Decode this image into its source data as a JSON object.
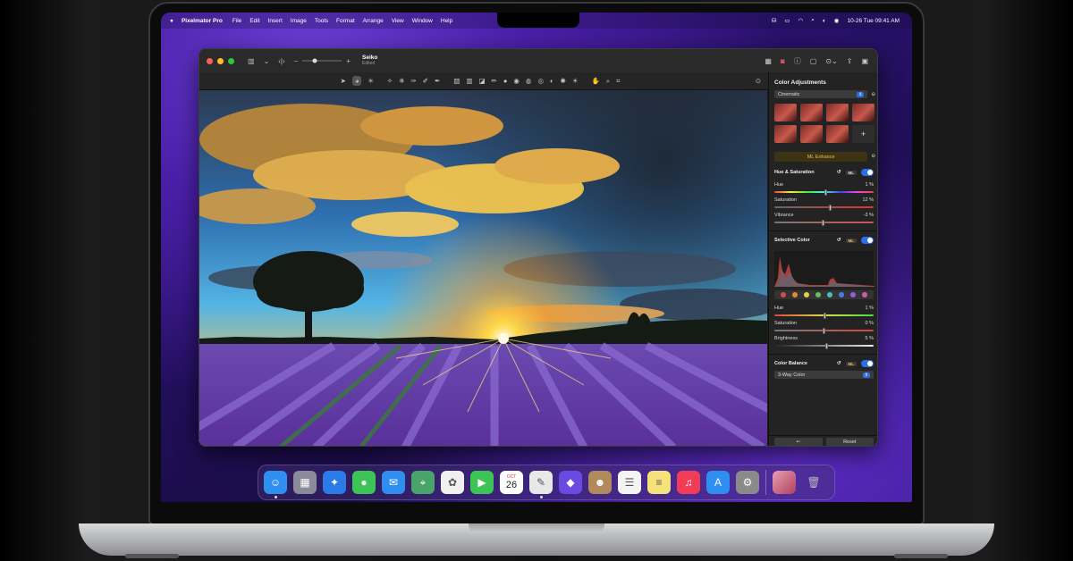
{
  "menubar": {
    "app_name": "Pixelmator Pro",
    "items": [
      "File",
      "Edit",
      "Insert",
      "Image",
      "Tools",
      "Format",
      "Arrange",
      "View",
      "Window",
      "Help"
    ],
    "datetime": "10-26 Tue  09:41 AM"
  },
  "window": {
    "doc_title": "Seiko",
    "doc_subtitle": "Edited"
  },
  "panel": {
    "title": "Color Adjustments",
    "preset_popup": "Cinematic",
    "ml_enhance": "ML Enhance",
    "hue_saturation": {
      "title": "Hue & Saturation",
      "ml": "ML",
      "sliders": [
        {
          "label": "Hue",
          "value": "1 %",
          "pos": 0.52
        },
        {
          "label": "Saturation",
          "value": "12 %",
          "pos": 0.56
        },
        {
          "label": "Vibrance",
          "value": "-3 %",
          "pos": 0.49
        }
      ]
    },
    "selective_color": {
      "title": "Selective Color",
      "ml": "ML",
      "sliders": [
        {
          "label": "Hue",
          "value": "1 %",
          "pos": 0.51
        },
        {
          "label": "Saturation",
          "value": "0 %",
          "pos": 0.5
        },
        {
          "label": "Brightness",
          "value": "5 %",
          "pos": 0.53
        }
      ],
      "swatches": [
        "#d94a4a",
        "#e08a3a",
        "#e6d24a",
        "#5fc25a",
        "#4ac0c0",
        "#4a7ae6",
        "#9a5ae6",
        "#d05ab0"
      ]
    },
    "color_balance": {
      "title": "Color Balance",
      "ml": "ML",
      "mode": "3-Way Color"
    },
    "footer": {
      "reset": "Reset"
    }
  },
  "dock": {
    "apps": [
      {
        "name": "finder-icon",
        "color": "#2f8ff0",
        "glyph": "☺",
        "running": true
      },
      {
        "name": "launchpad-icon",
        "color": "#8a8a9a",
        "glyph": "▦",
        "running": false
      },
      {
        "name": "safari-icon",
        "color": "#2a7ae8",
        "glyph": "✦",
        "running": false
      },
      {
        "name": "messages-icon",
        "color": "#3cc456",
        "glyph": "●",
        "running": false
      },
      {
        "name": "mail-icon",
        "color": "#2f8ff0",
        "glyph": "✉",
        "running": false
      },
      {
        "name": "maps-icon",
        "color": "#4aa36a",
        "glyph": "⌖",
        "running": false
      },
      {
        "name": "photos-icon",
        "color": "#f0f0f0",
        "glyph": "✿",
        "running": false
      },
      {
        "name": "facetime-icon",
        "color": "#3cc456",
        "glyph": "▶",
        "running": false
      },
      {
        "name": "calendar-icon",
        "color": "#ffffff",
        "glyph": "26",
        "running": false
      },
      {
        "name": "pixelmator-icon",
        "color": "#e8e8e8",
        "glyph": "✎",
        "running": true
      },
      {
        "name": "shortcuts-icon",
        "color": "#6a4ae0",
        "glyph": "◆",
        "running": false
      },
      {
        "name": "contacts-icon",
        "color": "#b08a5a",
        "glyph": "☻",
        "running": false
      },
      {
        "name": "reminders-icon",
        "color": "#f4f4f4",
        "glyph": "☰",
        "running": false
      },
      {
        "name": "notes-icon",
        "color": "#f6e27a",
        "glyph": "≡",
        "running": false
      },
      {
        "name": "music-icon",
        "color": "#f23c56",
        "glyph": "♫",
        "running": false
      },
      {
        "name": "app-store-icon",
        "color": "#2f8ff0",
        "glyph": "A",
        "running": false
      },
      {
        "name": "system-preferences-icon",
        "color": "#8a8a8a",
        "glyph": "⚙",
        "running": false
      }
    ],
    "calendar_month": "OCT"
  }
}
